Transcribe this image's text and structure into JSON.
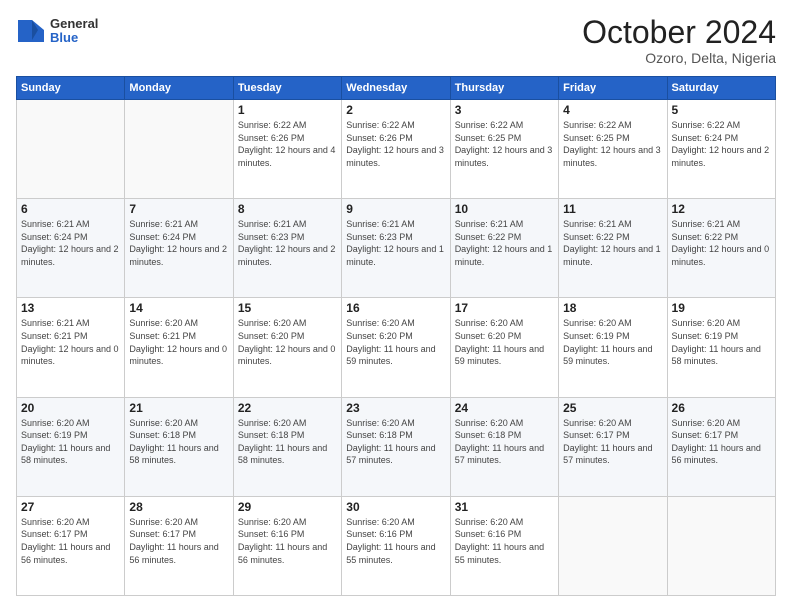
{
  "logo": {
    "general": "General",
    "blue": "Blue"
  },
  "header": {
    "month": "October 2024",
    "location": "Ozoro, Delta, Nigeria"
  },
  "weekdays": [
    "Sunday",
    "Monday",
    "Tuesday",
    "Wednesday",
    "Thursday",
    "Friday",
    "Saturday"
  ],
  "weeks": [
    [
      {
        "day": "",
        "info": ""
      },
      {
        "day": "",
        "info": ""
      },
      {
        "day": "1",
        "info": "Sunrise: 6:22 AM\nSunset: 6:26 PM\nDaylight: 12 hours and 4 minutes."
      },
      {
        "day": "2",
        "info": "Sunrise: 6:22 AM\nSunset: 6:26 PM\nDaylight: 12 hours and 3 minutes."
      },
      {
        "day": "3",
        "info": "Sunrise: 6:22 AM\nSunset: 6:25 PM\nDaylight: 12 hours and 3 minutes."
      },
      {
        "day": "4",
        "info": "Sunrise: 6:22 AM\nSunset: 6:25 PM\nDaylight: 12 hours and 3 minutes."
      },
      {
        "day": "5",
        "info": "Sunrise: 6:22 AM\nSunset: 6:24 PM\nDaylight: 12 hours and 2 minutes."
      }
    ],
    [
      {
        "day": "6",
        "info": "Sunrise: 6:21 AM\nSunset: 6:24 PM\nDaylight: 12 hours and 2 minutes."
      },
      {
        "day": "7",
        "info": "Sunrise: 6:21 AM\nSunset: 6:24 PM\nDaylight: 12 hours and 2 minutes."
      },
      {
        "day": "8",
        "info": "Sunrise: 6:21 AM\nSunset: 6:23 PM\nDaylight: 12 hours and 2 minutes."
      },
      {
        "day": "9",
        "info": "Sunrise: 6:21 AM\nSunset: 6:23 PM\nDaylight: 12 hours and 1 minute."
      },
      {
        "day": "10",
        "info": "Sunrise: 6:21 AM\nSunset: 6:22 PM\nDaylight: 12 hours and 1 minute."
      },
      {
        "day": "11",
        "info": "Sunrise: 6:21 AM\nSunset: 6:22 PM\nDaylight: 12 hours and 1 minute."
      },
      {
        "day": "12",
        "info": "Sunrise: 6:21 AM\nSunset: 6:22 PM\nDaylight: 12 hours and 0 minutes."
      }
    ],
    [
      {
        "day": "13",
        "info": "Sunrise: 6:21 AM\nSunset: 6:21 PM\nDaylight: 12 hours and 0 minutes."
      },
      {
        "day": "14",
        "info": "Sunrise: 6:20 AM\nSunset: 6:21 PM\nDaylight: 12 hours and 0 minutes."
      },
      {
        "day": "15",
        "info": "Sunrise: 6:20 AM\nSunset: 6:20 PM\nDaylight: 12 hours and 0 minutes."
      },
      {
        "day": "16",
        "info": "Sunrise: 6:20 AM\nSunset: 6:20 PM\nDaylight: 11 hours and 59 minutes."
      },
      {
        "day": "17",
        "info": "Sunrise: 6:20 AM\nSunset: 6:20 PM\nDaylight: 11 hours and 59 minutes."
      },
      {
        "day": "18",
        "info": "Sunrise: 6:20 AM\nSunset: 6:19 PM\nDaylight: 11 hours and 59 minutes."
      },
      {
        "day": "19",
        "info": "Sunrise: 6:20 AM\nSunset: 6:19 PM\nDaylight: 11 hours and 58 minutes."
      }
    ],
    [
      {
        "day": "20",
        "info": "Sunrise: 6:20 AM\nSunset: 6:19 PM\nDaylight: 11 hours and 58 minutes."
      },
      {
        "day": "21",
        "info": "Sunrise: 6:20 AM\nSunset: 6:18 PM\nDaylight: 11 hours and 58 minutes."
      },
      {
        "day": "22",
        "info": "Sunrise: 6:20 AM\nSunset: 6:18 PM\nDaylight: 11 hours and 58 minutes."
      },
      {
        "day": "23",
        "info": "Sunrise: 6:20 AM\nSunset: 6:18 PM\nDaylight: 11 hours and 57 minutes."
      },
      {
        "day": "24",
        "info": "Sunrise: 6:20 AM\nSunset: 6:18 PM\nDaylight: 11 hours and 57 minutes."
      },
      {
        "day": "25",
        "info": "Sunrise: 6:20 AM\nSunset: 6:17 PM\nDaylight: 11 hours and 57 minutes."
      },
      {
        "day": "26",
        "info": "Sunrise: 6:20 AM\nSunset: 6:17 PM\nDaylight: 11 hours and 56 minutes."
      }
    ],
    [
      {
        "day": "27",
        "info": "Sunrise: 6:20 AM\nSunset: 6:17 PM\nDaylight: 11 hours and 56 minutes."
      },
      {
        "day": "28",
        "info": "Sunrise: 6:20 AM\nSunset: 6:17 PM\nDaylight: 11 hours and 56 minutes."
      },
      {
        "day": "29",
        "info": "Sunrise: 6:20 AM\nSunset: 6:16 PM\nDaylight: 11 hours and 56 minutes."
      },
      {
        "day": "30",
        "info": "Sunrise: 6:20 AM\nSunset: 6:16 PM\nDaylight: 11 hours and 55 minutes."
      },
      {
        "day": "31",
        "info": "Sunrise: 6:20 AM\nSunset: 6:16 PM\nDaylight: 11 hours and 55 minutes."
      },
      {
        "day": "",
        "info": ""
      },
      {
        "day": "",
        "info": ""
      }
    ]
  ]
}
